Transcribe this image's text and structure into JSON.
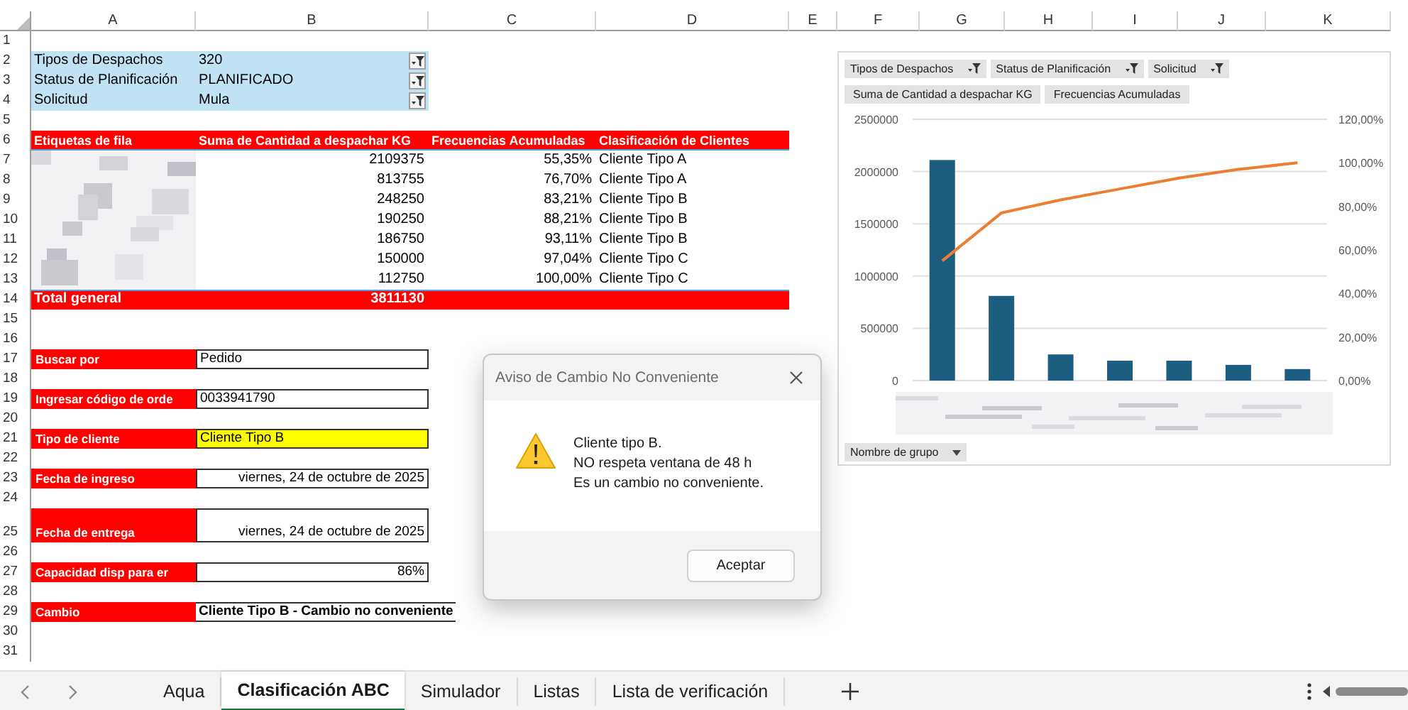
{
  "columns": [
    "A",
    "B",
    "C",
    "D",
    "E",
    "F",
    "G",
    "H",
    "I",
    "J",
    "K"
  ],
  "row_numbers": [
    "1",
    "2",
    "3",
    "4",
    "5",
    "6",
    "7",
    "8",
    "9",
    "10",
    "11",
    "12",
    "13",
    "14",
    "15",
    "16",
    "17",
    "18",
    "19",
    "20",
    "21",
    "22",
    "23",
    "24",
    "25",
    "26",
    "27",
    "28",
    "29",
    "30",
    "31"
  ],
  "filters": [
    {
      "label": "Tipos de Despachos",
      "value": "320"
    },
    {
      "label": "Status de Planificación",
      "value": "PLANIFICADO"
    },
    {
      "label": "Solicitud",
      "value": "Mula"
    }
  ],
  "pivot": {
    "headers": [
      "Etiquetas de fila",
      "Suma de Cantidad a despachar KG",
      "Frecuencias Acumuladas",
      "Clasificación de Clientes"
    ],
    "rows": [
      {
        "amount": "2109375",
        "cumulative": "55,35%",
        "classification": "Cliente Tipo A"
      },
      {
        "amount": "813755",
        "cumulative": "76,70%",
        "classification": "Cliente Tipo A"
      },
      {
        "amount": "248250",
        "cumulative": "83,21%",
        "classification": "Cliente Tipo B"
      },
      {
        "amount": "190250",
        "cumulative": "88,21%",
        "classification": "Cliente Tipo B"
      },
      {
        "amount": "186750",
        "cumulative": "93,11%",
        "classification": "Cliente Tipo B"
      },
      {
        "amount": "150000",
        "cumulative": "97,04%",
        "classification": "Cliente Tipo C"
      },
      {
        "amount": "112750",
        "cumulative": "100,00%",
        "classification": "Cliente Tipo C"
      }
    ],
    "total": {
      "label": "Total general",
      "amount": "3811130"
    }
  },
  "form": [
    {
      "label": "Buscar por",
      "value": "Pedido",
      "kind": "text"
    },
    {
      "label": "Ingresar código de orde",
      "value": "0033941790",
      "kind": "text"
    },
    {
      "label": "Tipo de cliente",
      "value": "Cliente Tipo B",
      "kind": "highlight"
    },
    {
      "label": "Fecha de ingreso",
      "value": "viernes, 24 de octubre de 2025",
      "kind": "right"
    },
    {
      "label": "Fecha de entrega",
      "value": "viernes, 24 de octubre de 2025",
      "kind": "right"
    },
    {
      "label": "Capacidad disp para er",
      "value": "86%",
      "kind": "right"
    },
    {
      "label": "Cambio",
      "value": "Cliente Tipo B - Cambio no conveniente",
      "kind": "bold"
    }
  ],
  "chart": {
    "filter_buttons": [
      "Tipos de Despachos",
      "Status de Planificación",
      "Solicitud"
    ],
    "axis_button": "Nombre de grupo",
    "chart_data": {
      "type": "bar",
      "series": [
        {
          "name": "Suma de Cantidad a despachar KG",
          "color": "#1b5e80",
          "values": [
            2110000,
            810000,
            250000,
            190000,
            190000,
            150000,
            110000
          ]
        },
        {
          "name": "Frecuencias Acumuladas",
          "color": "#ed7d31",
          "type": "line",
          "axis": "y2",
          "values": [
            55,
            77,
            83,
            88,
            93,
            97,
            100
          ]
        }
      ],
      "grid": true,
      "ylim": [
        0,
        2500000
      ],
      "yticks": [
        0,
        500000,
        1000000,
        1500000,
        2000000,
        2500000
      ],
      "y2lim": [
        0,
        120
      ],
      "y2ticks": [
        {
          "value": 0,
          "label": "0,00%"
        },
        {
          "value": 20,
          "label": "20,00%"
        },
        {
          "value": 40,
          "label": "40,00%"
        },
        {
          "value": 60,
          "label": "60,00%"
        },
        {
          "value": 80,
          "label": "80,00%"
        },
        {
          "value": 100,
          "label": "100,00%"
        },
        {
          "value": 120,
          "label": "120,00%"
        }
      ]
    }
  },
  "dialog": {
    "title": "Aviso de Cambio No Conveniente",
    "lines": [
      "Cliente tipo B.",
      "NO respeta ventana de 48 h",
      "Es un cambio no conveniente."
    ],
    "button": "Aceptar"
  },
  "sheet_tabs": [
    {
      "label": "Aqua",
      "selected": false
    },
    {
      "label": "Clasificación ABC",
      "selected": true
    },
    {
      "label": "Simulador",
      "selected": false
    },
    {
      "label": "Listas",
      "selected": false
    },
    {
      "label": "Lista de verificación",
      "selected": false
    }
  ]
}
